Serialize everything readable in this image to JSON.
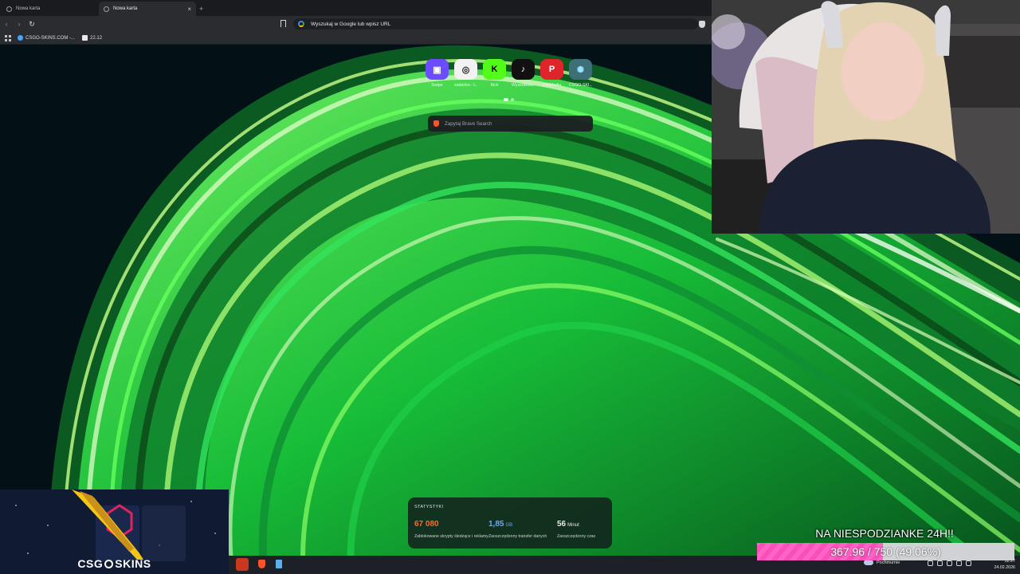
{
  "browser": {
    "tabs": [
      {
        "label": "Nowa karta",
        "active": false
      },
      {
        "label": "Nowa karta",
        "active": true
      }
    ],
    "address_placeholder": "Wyszukaj w Google lub wpisz URL",
    "bookmarks": [
      {
        "label": "CSGO-SKINS.COM -...",
        "icon": "csgo-skins-favicon"
      },
      {
        "label": "22.12",
        "icon": "page-favicon"
      }
    ]
  },
  "newtab": {
    "speed_dials": [
      {
        "label": "Swipe",
        "glyph": "▣",
        "bg": "#6d4cff",
        "fg": "#ffffff"
      },
      {
        "label": "zadanka - L...",
        "glyph": "◎",
        "bg": "#f2f2f2",
        "fg": "#222222"
      },
      {
        "label": "Kick",
        "glyph": "K",
        "bg": "#53fc18",
        "fg": "#000000"
      },
      {
        "label": "Wyszukiwa...",
        "glyph": "♪",
        "bg": "#111111",
        "fg": "#ffffff"
      },
      {
        "label": "PayMedia",
        "glyph": "P",
        "bg": "#e0242b",
        "fg": "#ffffff"
      },
      {
        "label": "CSGO-SKI...",
        "glyph": "✺",
        "bg": "#3d6f76",
        "fg": "#9be3ff"
      }
    ],
    "search_placeholder": "Zapytaj Brave Search",
    "stats": {
      "title": "STATYSTYKI",
      "items": [
        {
          "value": "67 080",
          "unit": "",
          "desc": "Zablokowane skrypty śledzące i reklamy",
          "color": "#ff6a2b"
        },
        {
          "value": "1,85",
          "unit": "GB",
          "desc": "Zaoszczędzony transfer danych",
          "color": "#6aa7ff"
        },
        {
          "value": "56",
          "unit": "Minut",
          "desc": "Zaoszczędzony czas",
          "color": "#ffffff"
        }
      ]
    }
  },
  "overlay": {
    "goal_title": "NA NIESPODZIANKE 24H!!",
    "goal_text": "367.96 / 750 (49.06%)",
    "goal_progress": 0.4906,
    "sponsor_brand_left": "CSG",
    "sponsor_brand_right": "SKINS"
  },
  "taskbar": {
    "weather": "Pochmurnie",
    "time": "02:27",
    "date": "24.02.2026"
  },
  "colors": {
    "accent_pink": "#ff63c8",
    "brave_orange": "#fb542b"
  }
}
